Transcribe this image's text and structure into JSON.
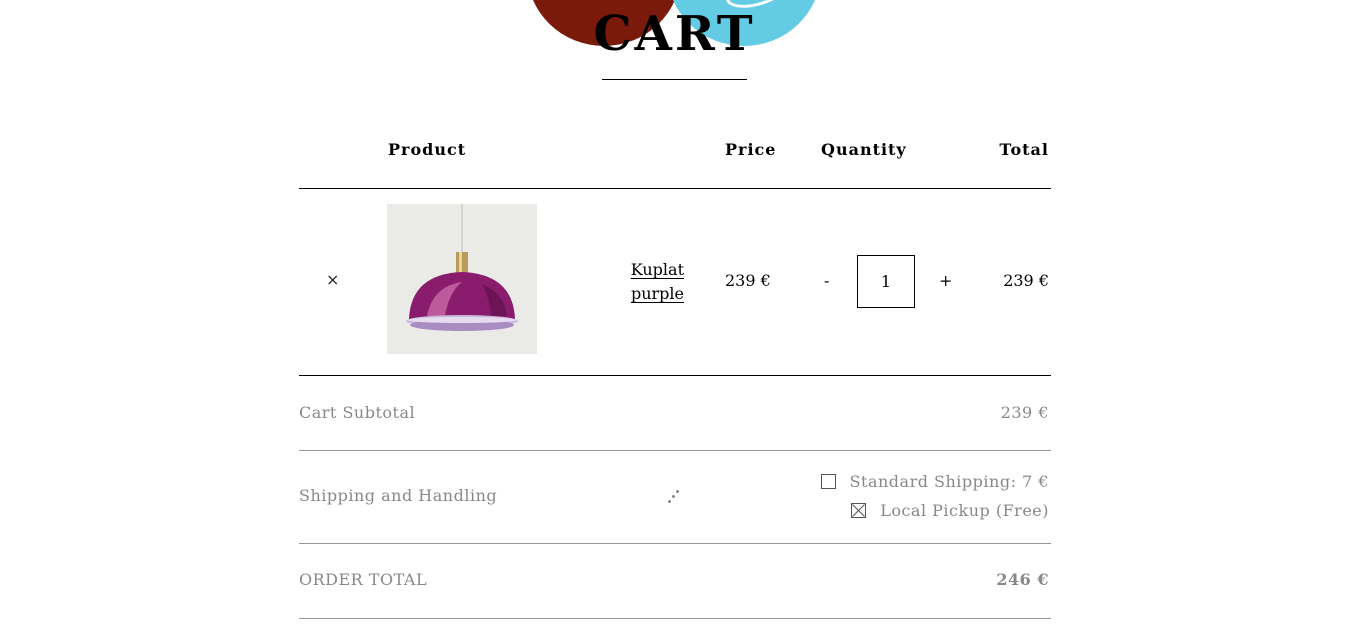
{
  "header": {
    "title": "CART"
  },
  "table": {
    "headers": {
      "product": "Product",
      "price": "Price",
      "quantity": "Quantity",
      "total": "Total"
    },
    "items": [
      {
        "remove_label": "×",
        "name": "Kuplat purple",
        "price": "239 €",
        "quantity": "1",
        "decrement": "-",
        "increment": "+",
        "total": "239 €"
      }
    ]
  },
  "summary": {
    "subtotal_label": "Cart Subtotal",
    "subtotal_value": "239 €",
    "shipping_label": "Shipping and Handling",
    "shipping_options": [
      {
        "label": "Standard Shipping: 7 €",
        "checked": false
      },
      {
        "label": "Local Pickup (Free)",
        "checked": true
      }
    ],
    "order_total_label": "ORDER TOTAL",
    "order_total_value": "246 €"
  }
}
